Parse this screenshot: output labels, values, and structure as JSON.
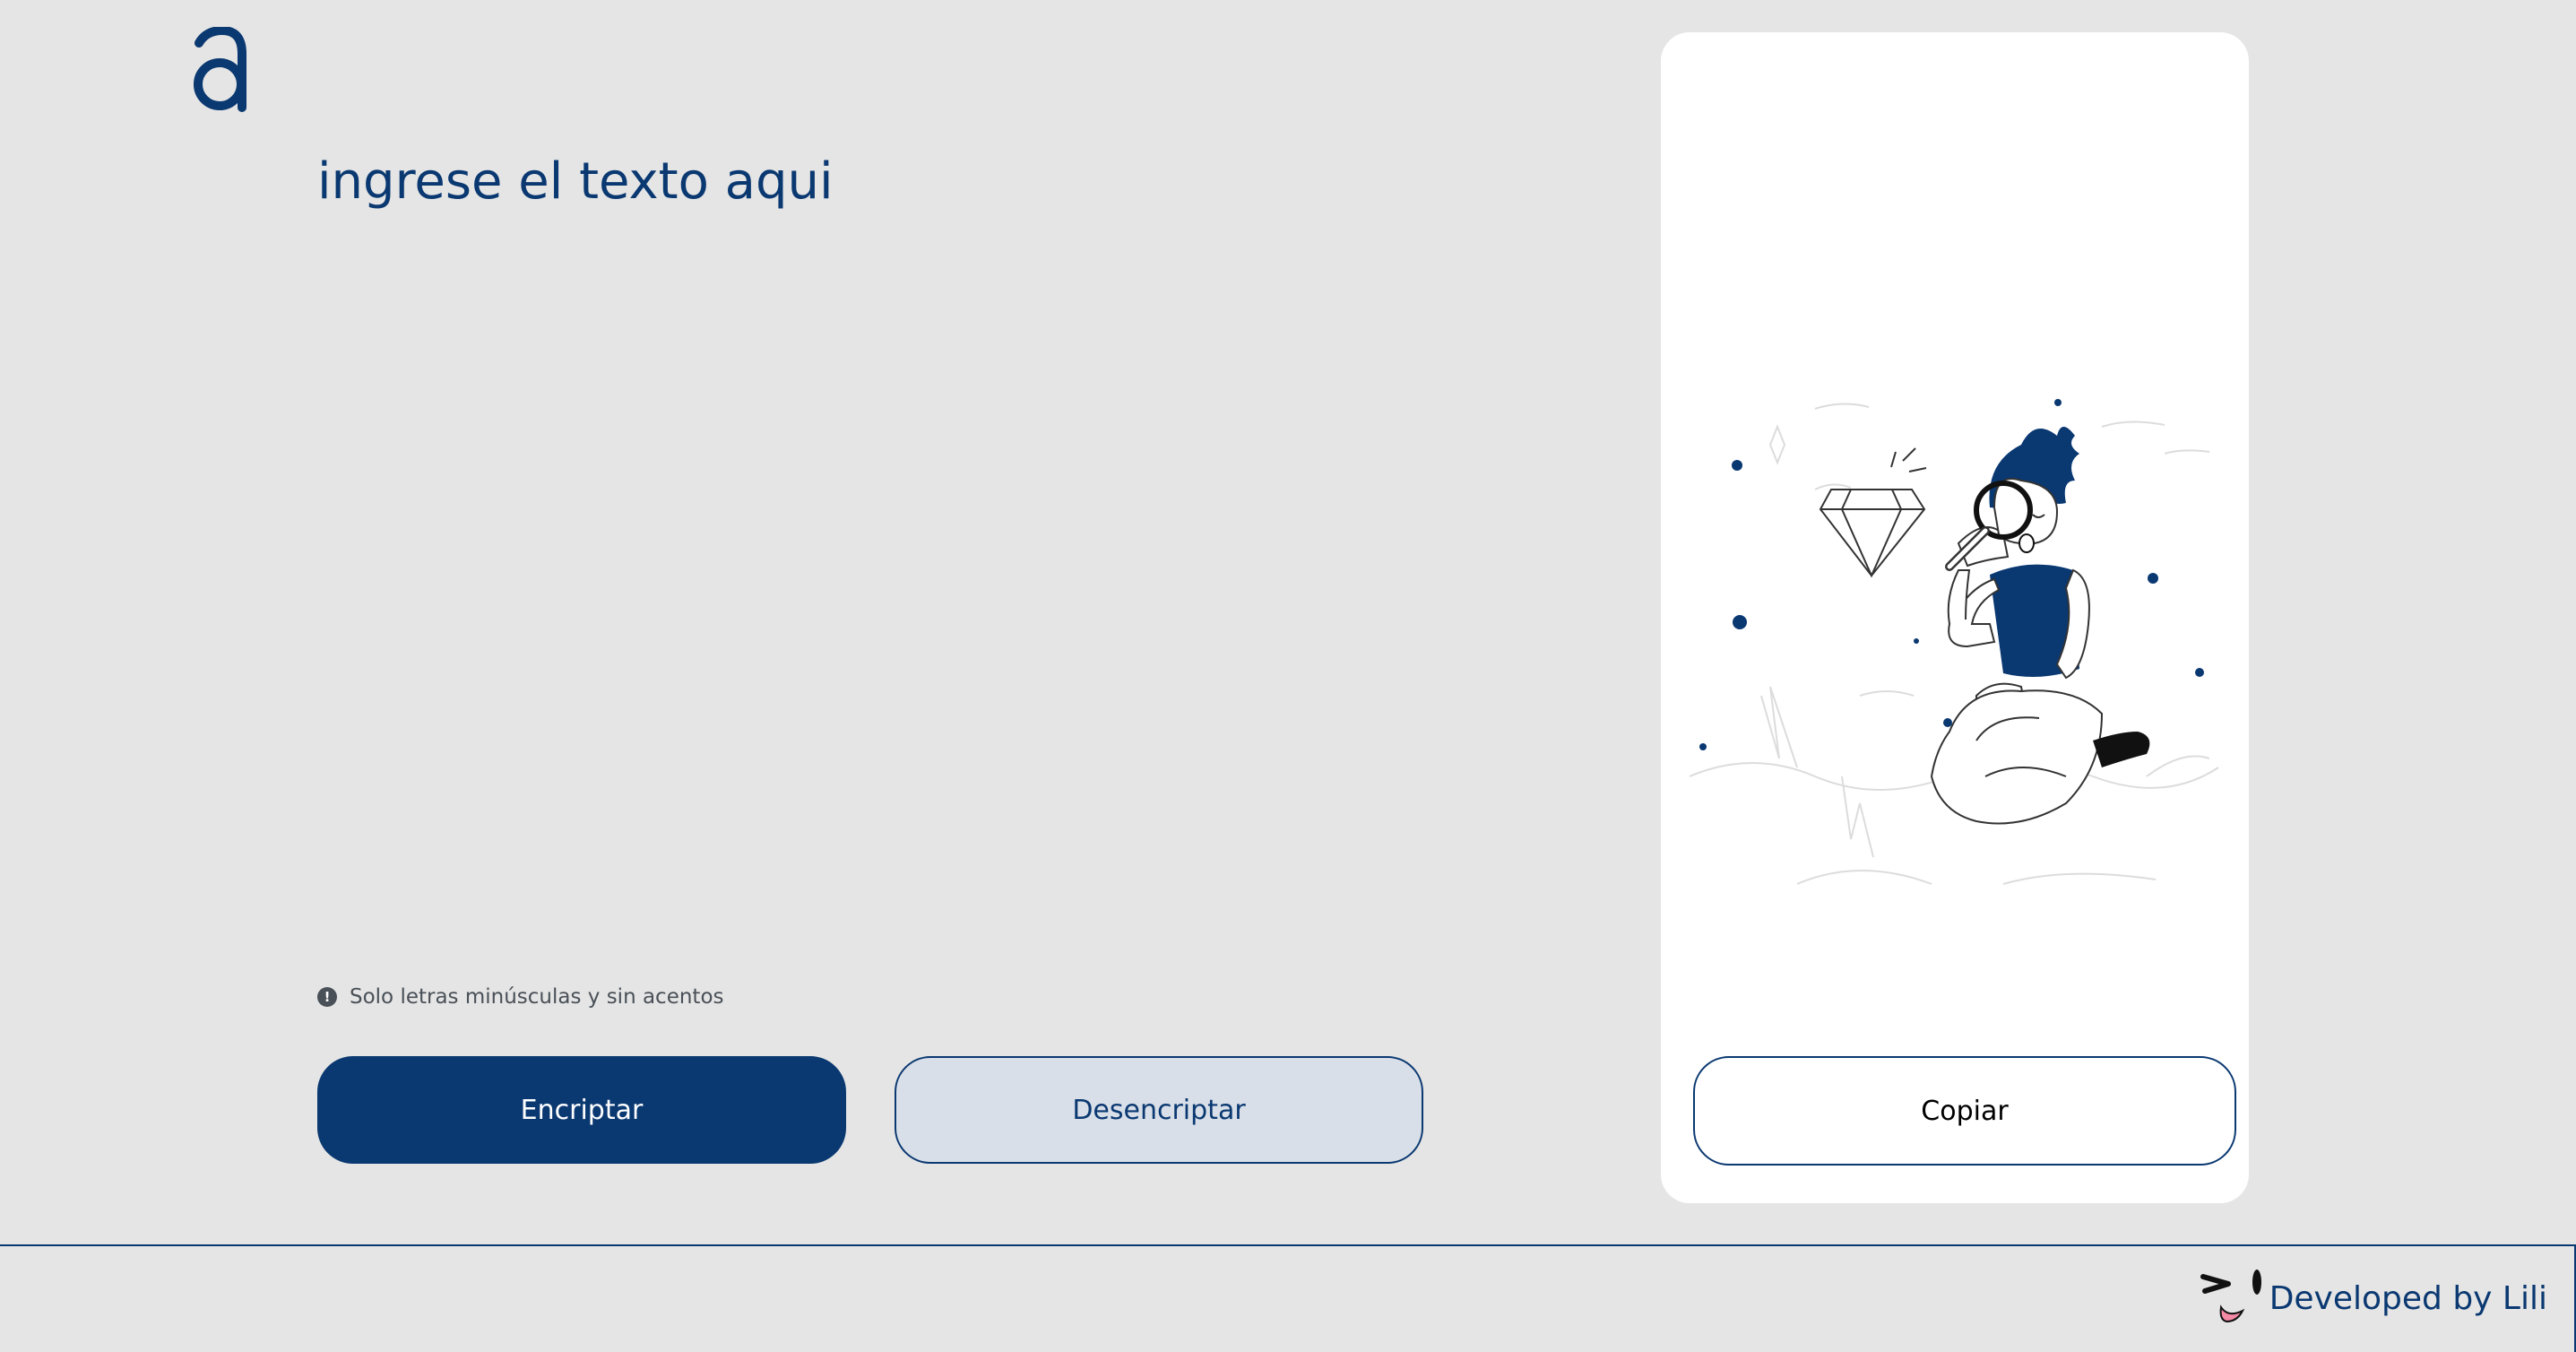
{
  "brand": {
    "logo_icon": "alura-a-logo-icon",
    "accent_color": "#0a3871"
  },
  "input": {
    "placeholder": "ingrese el texto aqui",
    "value": ""
  },
  "hint": {
    "icon": "exclamation-circle-icon",
    "text": "Solo letras minúsculas y sin acentos"
  },
  "actions": {
    "encrypt_label": "Encriptar",
    "decrypt_label": "Desencriptar"
  },
  "output_panel": {
    "illustration": "person-with-magnifying-glass-and-diamond-illustration",
    "copy_label": "Copiar"
  },
  "footer": {
    "face_icon": "winking-face-icon",
    "credit": "Developed by Lili"
  }
}
